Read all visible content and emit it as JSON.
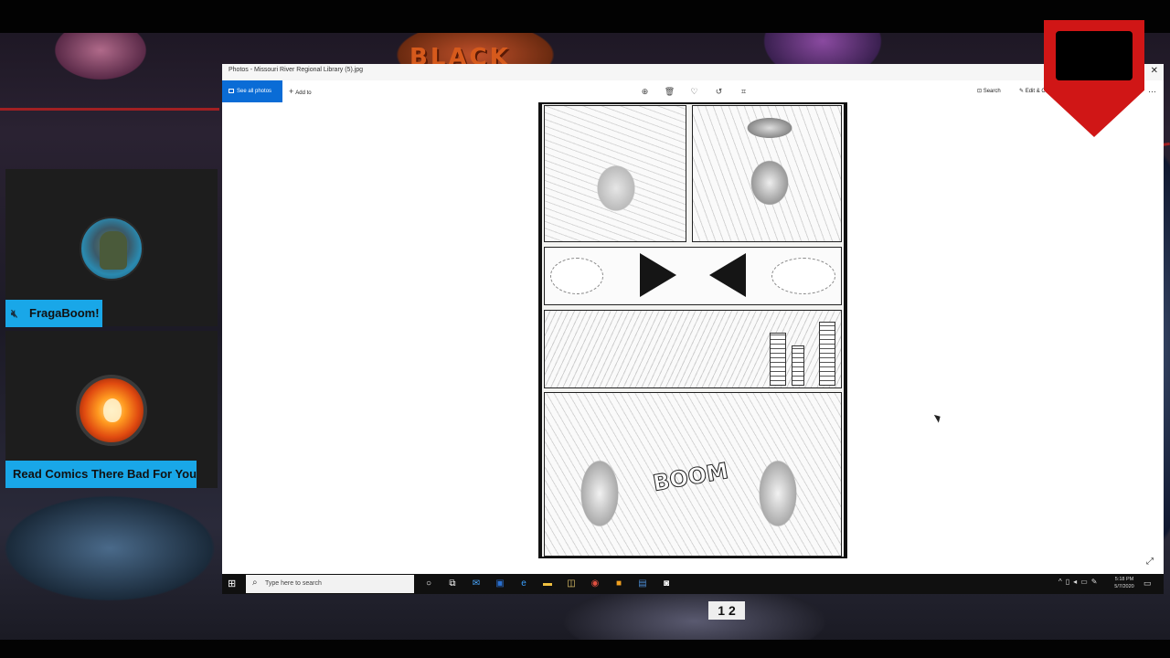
{
  "background": {
    "title_art": "BLACK",
    "badge": "1 2"
  },
  "cams": [
    {
      "name": "FragaBoom!"
    },
    {
      "name": "Read Comics There Bad For You"
    }
  ],
  "window": {
    "title": "Photos - Missouri River Regional Library (5).jpg",
    "see_all": "See all photos",
    "add_to": "Add to",
    "search": "Search",
    "edit": "Edit & Create",
    "boom": "BOOM"
  },
  "taskbar": {
    "search_placeholder": "Type here to search",
    "time": "5:18 PM",
    "date": "5/7/2020"
  },
  "colors": {
    "accent": "#0a6cd6",
    "name_tag": "#19a7e8",
    "shield": "#d01616"
  },
  "icons": [
    "zoom-icon",
    "delete-icon",
    "heart-icon",
    "rotate-icon",
    "crop-icon",
    "search-icon",
    "edit-icon",
    "more-icon",
    "mic-muted-icon",
    "windows-icon"
  ]
}
